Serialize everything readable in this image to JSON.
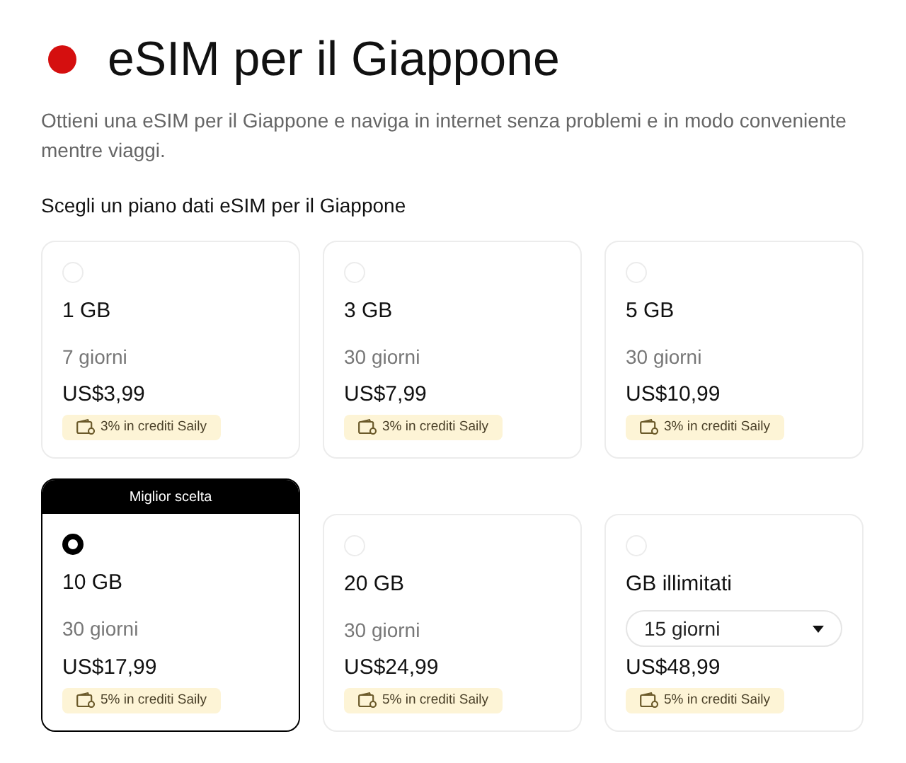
{
  "title": "eSIM per il Giappone",
  "description": "Ottieni una eSIM per il Giappone e naviga in internet senza problemi e in modo conveniente mentre viaggi.",
  "section_title": "Scegli un piano dati eSIM per il Giappone",
  "plans": [
    {
      "kind": "fixed",
      "data": "1 GB",
      "duration": "7 giorni",
      "price": "US$3,99",
      "credits": "3% in crediti Saily",
      "selected": false
    },
    {
      "kind": "fixed",
      "data": "3 GB",
      "duration": "30 giorni",
      "price": "US$7,99",
      "credits": "3% in crediti Saily",
      "selected": false
    },
    {
      "kind": "fixed",
      "data": "5 GB",
      "duration": "30 giorni",
      "price": "US$10,99",
      "credits": "3% in crediti Saily",
      "selected": false
    },
    {
      "kind": "fixed",
      "badge": "Miglior scelta",
      "data": "10 GB",
      "duration": "30 giorni",
      "price": "US$17,99",
      "credits": "5% in crediti Saily",
      "selected": true
    },
    {
      "kind": "fixed",
      "data": "20 GB",
      "duration": "30 giorni",
      "price": "US$24,99",
      "credits": "5% in crediti Saily",
      "selected": false
    },
    {
      "kind": "dropdown",
      "data": "GB illimitati",
      "duration": "15 giorni",
      "price": "US$48,99",
      "credits": "5% in crediti Saily",
      "selected": false
    }
  ]
}
